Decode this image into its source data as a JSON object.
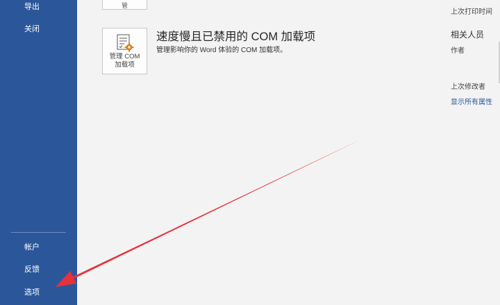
{
  "sidebar": {
    "items_top": [
      {
        "label": "导出"
      },
      {
        "label": "关闭"
      }
    ],
    "items_bottom": [
      {
        "label": "帐户"
      },
      {
        "label": "反馈"
      },
      {
        "label": "选项"
      }
    ],
    "background": "#2b579a"
  },
  "main": {
    "top_tile_label": "管",
    "com_section": {
      "tile_label_line1": "管理 COM",
      "tile_label_line2": "加载项",
      "title": "速度慢且已禁用的 COM 加载项",
      "description": "管理影响你的 Word 体验的 COM 加载项。"
    }
  },
  "properties": {
    "last_print_time": "上次打印时间",
    "related_people": "相关人员",
    "author": "作者",
    "last_modified_by": "上次修改者",
    "show_all_properties": "显示所有属性"
  },
  "annotation": {
    "arrow_color": "#e8313a",
    "arrow_target": "选项"
  }
}
